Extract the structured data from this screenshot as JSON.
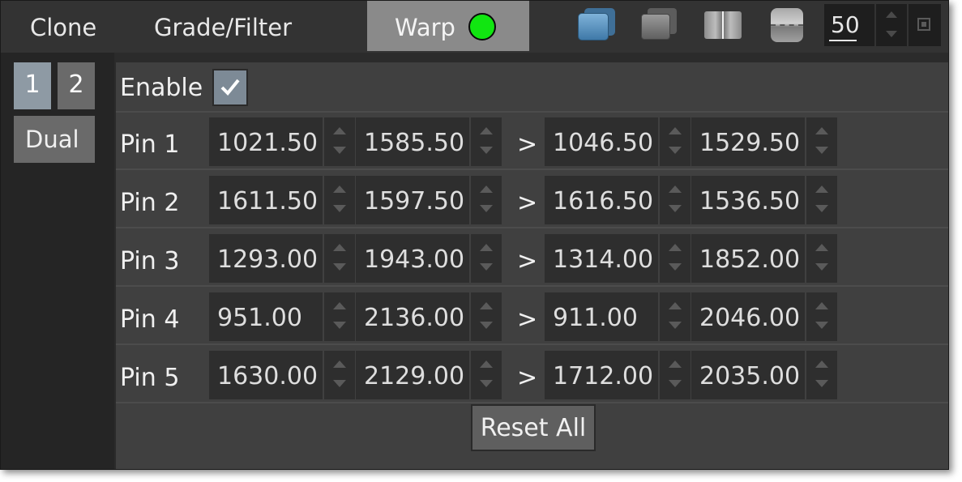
{
  "tabs": {
    "clone": "Clone",
    "grade_filter": "Grade/Filter",
    "warp": "Warp"
  },
  "toolbar": {
    "zoom_value": "50",
    "icons": [
      "blue-layers-icon",
      "gray-layers-icon",
      "vertical-split-icon",
      "horizontal-split-icon",
      "pin-square-icon"
    ],
    "warp_status_color": "#11e611"
  },
  "side": {
    "btn_1": "1",
    "btn_2": "2",
    "dual": "Dual"
  },
  "enable": {
    "label": "Enable",
    "checked": true
  },
  "separator": ">",
  "pins": [
    {
      "label": "Pin 1",
      "src_x": "1021.50",
      "src_y": "1585.50",
      "dst_x": "1046.50",
      "dst_y": "1529.50"
    },
    {
      "label": "Pin 2",
      "src_x": "1611.50",
      "src_y": "1597.50",
      "dst_x": "1616.50",
      "dst_y": "1536.50"
    },
    {
      "label": "Pin 3",
      "src_x": "1293.00",
      "src_y": "1943.00",
      "dst_x": "1314.00",
      "dst_y": "1852.00"
    },
    {
      "label": "Pin 4",
      "src_x": "951.00",
      "src_y": "2136.00",
      "dst_x": "911.00",
      "dst_y": "2046.00"
    },
    {
      "label": "Pin 5",
      "src_x": "1630.00",
      "src_y": "2129.00",
      "dst_x": "1712.00",
      "dst_y": "2035.00"
    }
  ],
  "reset_label": "Reset All"
}
